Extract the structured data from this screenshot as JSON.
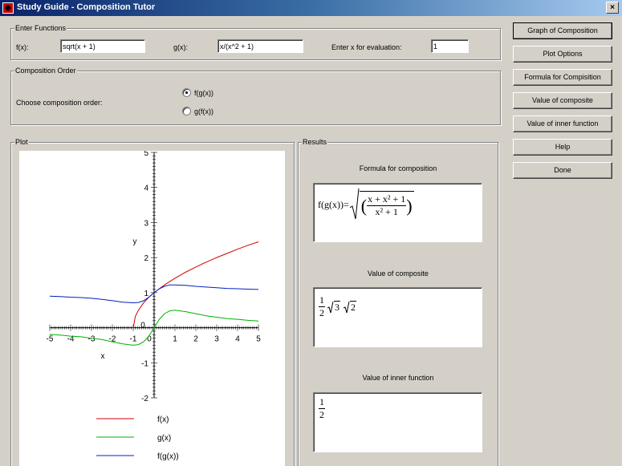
{
  "window": {
    "title": "Study Guide - Composition Tutor",
    "close_glyph": "×"
  },
  "enter_functions": {
    "label": "Enter Functions",
    "f_label": "f(x):",
    "f_value": "sqrt(x + 1)",
    "g_label": "g(x):",
    "g_value": "x/(x^2 + 1)",
    "x_label": "Enter x for evaluation:",
    "x_value": "1"
  },
  "composition_order": {
    "label": "Composition Order",
    "prompt": "Choose composition order:",
    "options": [
      {
        "label": "f(g(x))",
        "checked": true
      },
      {
        "label": "g(f(x))",
        "checked": false
      }
    ]
  },
  "buttons": [
    "Graph of Composition",
    "Plot Options",
    "Formula for Compisition",
    "Value of composite",
    "Value of inner function",
    "Help",
    "Done"
  ],
  "plot": {
    "label": "Plot",
    "chart_data": {
      "type": "line",
      "xlabel": "x",
      "ylabel": "y",
      "xlim": [
        -5,
        5
      ],
      "ylim": [
        -2,
        5
      ],
      "xticks": [
        -5,
        -4,
        -3,
        -2,
        -1,
        0,
        1,
        2,
        3,
        4,
        5
      ],
      "yticks": [
        -2,
        -1,
        0,
        1,
        2,
        3,
        4,
        5
      ],
      "series": [
        {
          "name": "f(x)",
          "color": "#d00000",
          "x": [
            -1,
            -0.9,
            -0.75,
            -0.5,
            -0.25,
            0,
            0.5,
            1,
            1.5,
            2,
            2.5,
            3,
            3.5,
            4,
            4.5,
            5
          ],
          "y": [
            0,
            0.32,
            0.5,
            0.71,
            0.87,
            1,
            1.22,
            1.41,
            1.58,
            1.73,
            1.87,
            2,
            2.12,
            2.24,
            2.35,
            2.45
          ]
        },
        {
          "name": "g(x)",
          "color": "#00b000",
          "x": [
            -5,
            -4.5,
            -4,
            -3.5,
            -3,
            -2.5,
            -2,
            -1.5,
            -1,
            -0.75,
            -0.5,
            -0.25,
            0,
            0.25,
            0.5,
            0.75,
            1,
            1.5,
            2,
            2.5,
            3,
            3.5,
            4,
            4.5,
            5
          ],
          "y": [
            -0.19,
            -0.21,
            -0.24,
            -0.26,
            -0.3,
            -0.34,
            -0.4,
            -0.46,
            -0.5,
            -0.48,
            -0.4,
            -0.24,
            0,
            0.24,
            0.4,
            0.48,
            0.5,
            0.46,
            0.4,
            0.34,
            0.3,
            0.26,
            0.24,
            0.21,
            0.19
          ]
        },
        {
          "name": "f(g(x))",
          "color": "#0020c0",
          "x": [
            -5,
            -4.5,
            -4,
            -3.5,
            -3,
            -2.5,
            -2,
            -1.5,
            -1,
            -0.75,
            -0.5,
            -0.25,
            0,
            0.25,
            0.5,
            0.75,
            1,
            1.5,
            2,
            2.5,
            3,
            3.5,
            4,
            4.5,
            5
          ],
          "y": [
            0.9,
            0.89,
            0.87,
            0.86,
            0.84,
            0.81,
            0.77,
            0.73,
            0.71,
            0.72,
            0.77,
            0.87,
            1,
            1.11,
            1.18,
            1.22,
            1.22,
            1.21,
            1.18,
            1.16,
            1.14,
            1.12,
            1.11,
            1.1,
            1.09
          ]
        }
      ],
      "legend": "bottom"
    }
  },
  "results": {
    "label": "Results",
    "formula_title": "Formula for composition",
    "formula": {
      "lhs": "f(g(x))=",
      "num": "x + x² + 1",
      "den": "x² + 1"
    },
    "composite_title": "Value of composite",
    "composite": {
      "num": "1",
      "den": "2",
      "rad1": "3",
      "rad2": "2"
    },
    "inner_title": "Value of inner function",
    "inner": {
      "num": "1",
      "den": "2"
    }
  }
}
